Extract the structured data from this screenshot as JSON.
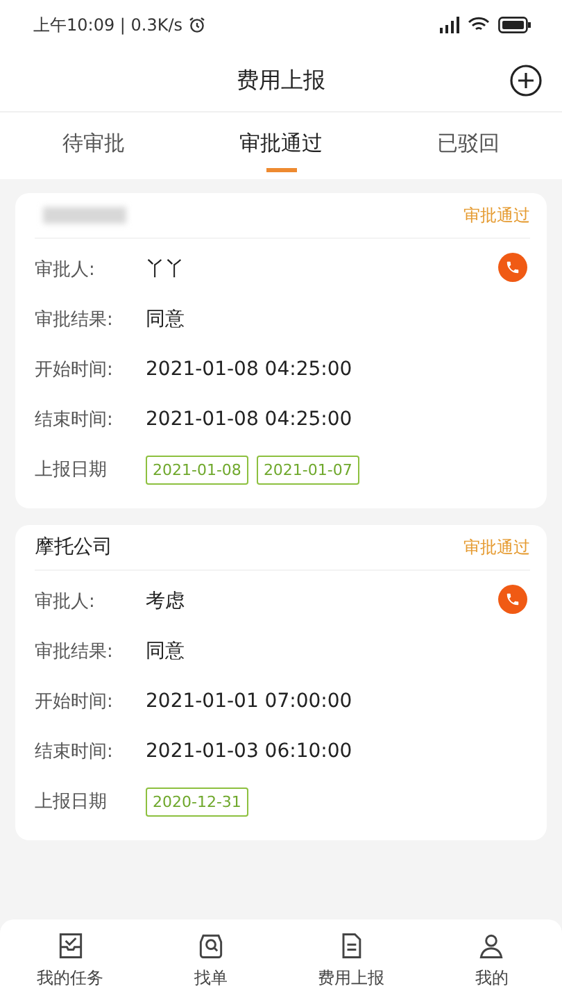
{
  "status_bar": {
    "time": "上午10:09 | 0.3K/s"
  },
  "header": {
    "title": "费用上报"
  },
  "tabs": [
    {
      "label": "待审批",
      "selected": false
    },
    {
      "label": "审批通过",
      "selected": true
    },
    {
      "label": "已驳回",
      "selected": false
    }
  ],
  "cards": [
    {
      "title_redacted": true,
      "status": "审批通过",
      "fields": [
        {
          "label": "审批人:",
          "value": "丫丫"
        },
        {
          "label": "审批结果:",
          "value": "同意"
        },
        {
          "label": "开始时间:",
          "value": "2021-01-08 04:25:00"
        },
        {
          "label": "结束时间:",
          "value": "2021-01-08 04:25:00"
        }
      ],
      "dates_label": "上报日期",
      "dates": [
        "2021-01-08",
        "2021-01-07"
      ]
    },
    {
      "title": "摩托公司",
      "title_redacted": false,
      "status": "审批通过",
      "fields": [
        {
          "label": "审批人:",
          "value": "考虑"
        },
        {
          "label": "审批结果:",
          "value": "同意"
        },
        {
          "label": "开始时间:",
          "value": "2021-01-01 07:00:00"
        },
        {
          "label": "结束时间:",
          "value": "2021-01-03 06:10:00"
        }
      ],
      "dates_label": "上报日期",
      "dates": [
        "2020-12-31"
      ]
    }
  ],
  "bottom_nav": [
    {
      "label": "我的任务",
      "kind": "task"
    },
    {
      "label": "找单",
      "kind": "search"
    },
    {
      "label": "费用上报",
      "kind": "report"
    },
    {
      "label": "我的",
      "kind": "user"
    }
  ]
}
